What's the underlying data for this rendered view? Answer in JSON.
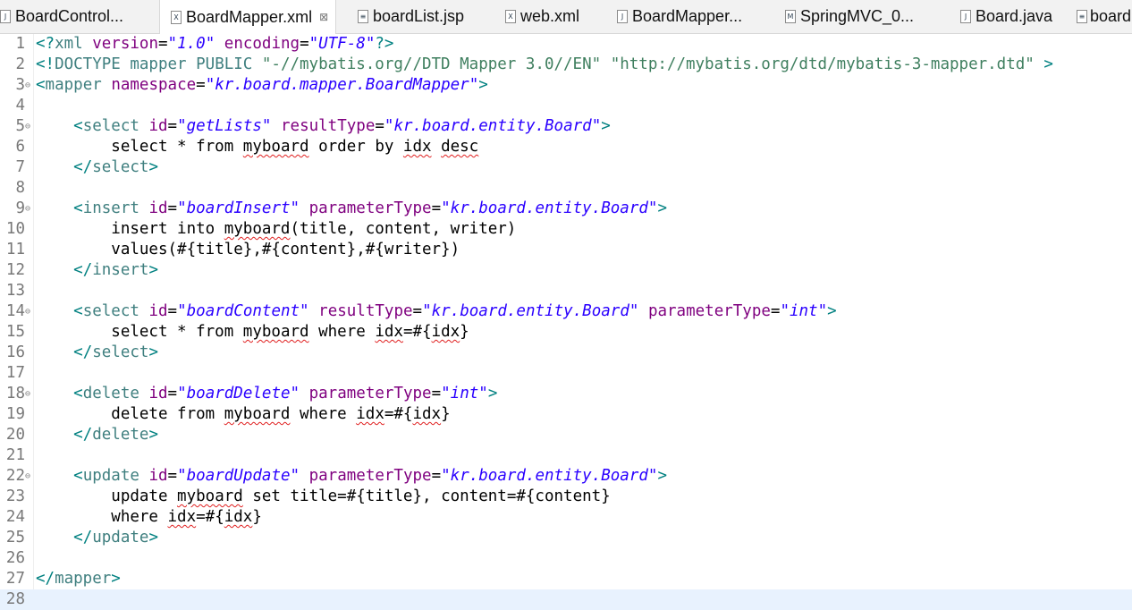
{
  "tabs": [
    {
      "label": "BoardControl...",
      "icon": "J",
      "active": false
    },
    {
      "label": "BoardMapper.xml",
      "icon": "X",
      "active": true
    },
    {
      "label": "boardList.jsp",
      "icon": "≡",
      "active": false
    },
    {
      "label": "web.xml",
      "icon": "X",
      "active": false
    },
    {
      "label": "BoardMapper...",
      "icon": "J",
      "active": false
    },
    {
      "label": "SpringMVC_0...",
      "icon": "M",
      "active": false
    },
    {
      "label": "Board.java",
      "icon": "J",
      "active": false
    },
    {
      "label": "board",
      "icon": "≡",
      "active": false
    }
  ],
  "close_glyph": "⊠",
  "fold_lines": [
    3,
    5,
    9,
    14,
    18,
    22
  ],
  "current_line": 28,
  "lines": [
    [
      [
        "br",
        "<?"
      ],
      [
        "tag",
        "xml"
      ],
      [
        "txt",
        " "
      ],
      [
        "attr",
        "version"
      ],
      [
        "txt",
        "="
      ],
      [
        "val",
        "\"1.0\""
      ],
      [
        "txt",
        " "
      ],
      [
        "attr",
        "encoding"
      ],
      [
        "txt",
        "="
      ],
      [
        "val",
        "\"UTF-8\""
      ],
      [
        "br",
        "?>"
      ]
    ],
    [
      [
        "br",
        "<!"
      ],
      [
        "dt",
        "DOCTYPE mapper PUBLIC "
      ],
      [
        "str",
        "\"-//mybatis.org//DTD Mapper 3.0//EN\" \"http://mybatis.org/dtd/mybatis-3-mapper.dtd\""
      ],
      [
        "br",
        " >"
      ]
    ],
    [
      [
        "br",
        "<"
      ],
      [
        "tag",
        "mapper"
      ],
      [
        "txt",
        " "
      ],
      [
        "attr",
        "namespace"
      ],
      [
        "txt",
        "="
      ],
      [
        "val",
        "\"kr.board.mapper.BoardMapper\""
      ],
      [
        "br",
        ">"
      ]
    ],
    [],
    [
      [
        "txt",
        "    "
      ],
      [
        "br",
        "<"
      ],
      [
        "tag",
        "select"
      ],
      [
        "txt",
        " "
      ],
      [
        "attr",
        "id"
      ],
      [
        "txt",
        "="
      ],
      [
        "val",
        "\"getLists\""
      ],
      [
        "txt",
        " "
      ],
      [
        "attr",
        "resultType"
      ],
      [
        "txt",
        "="
      ],
      [
        "val",
        "\"kr.board.entity.Board\""
      ],
      [
        "br",
        ">"
      ]
    ],
    [
      [
        "txt",
        "        select * from "
      ],
      [
        "sp",
        "myboard"
      ],
      [
        "txt",
        " order by "
      ],
      [
        "sp",
        "idx"
      ],
      [
        "txt",
        " "
      ],
      [
        "sp",
        "desc"
      ]
    ],
    [
      [
        "txt",
        "    "
      ],
      [
        "br",
        "</"
      ],
      [
        "tag",
        "select"
      ],
      [
        "br",
        ">"
      ]
    ],
    [],
    [
      [
        "txt",
        "    "
      ],
      [
        "br",
        "<"
      ],
      [
        "tag",
        "insert"
      ],
      [
        "txt",
        " "
      ],
      [
        "attr",
        "id"
      ],
      [
        "txt",
        "="
      ],
      [
        "val",
        "\"boardInsert\""
      ],
      [
        "txt",
        " "
      ],
      [
        "attr",
        "parameterType"
      ],
      [
        "txt",
        "="
      ],
      [
        "val",
        "\"kr.board.entity.Board\""
      ],
      [
        "br",
        ">"
      ]
    ],
    [
      [
        "txt",
        "        insert into "
      ],
      [
        "sp",
        "myboard"
      ],
      [
        "txt",
        "(title, content, writer)"
      ]
    ],
    [
      [
        "txt",
        "        values(#{title},#{content},#{writer})"
      ]
    ],
    [
      [
        "txt",
        "    "
      ],
      [
        "br",
        "</"
      ],
      [
        "tag",
        "insert"
      ],
      [
        "br",
        ">"
      ]
    ],
    [],
    [
      [
        "txt",
        "    "
      ],
      [
        "br",
        "<"
      ],
      [
        "tag",
        "select"
      ],
      [
        "txt",
        " "
      ],
      [
        "attr",
        "id"
      ],
      [
        "txt",
        "="
      ],
      [
        "val",
        "\"boardContent\""
      ],
      [
        "txt",
        " "
      ],
      [
        "attr",
        "resultType"
      ],
      [
        "txt",
        "="
      ],
      [
        "val",
        "\"kr.board.entity.Board\""
      ],
      [
        "txt",
        " "
      ],
      [
        "attr",
        "parameterType"
      ],
      [
        "txt",
        "="
      ],
      [
        "val",
        "\"int\""
      ],
      [
        "br",
        ">"
      ]
    ],
    [
      [
        "txt",
        "        select * from "
      ],
      [
        "sp",
        "myboard"
      ],
      [
        "txt",
        " where "
      ],
      [
        "sp",
        "idx"
      ],
      [
        "txt",
        "=#{"
      ],
      [
        "sp",
        "idx"
      ],
      [
        "txt",
        "}"
      ]
    ],
    [
      [
        "txt",
        "    "
      ],
      [
        "br",
        "</"
      ],
      [
        "tag",
        "select"
      ],
      [
        "br",
        ">"
      ]
    ],
    [],
    [
      [
        "txt",
        "    "
      ],
      [
        "br",
        "<"
      ],
      [
        "tag",
        "delete"
      ],
      [
        "txt",
        " "
      ],
      [
        "attr",
        "id"
      ],
      [
        "txt",
        "="
      ],
      [
        "val",
        "\"boardDelete\""
      ],
      [
        "txt",
        " "
      ],
      [
        "attr",
        "parameterType"
      ],
      [
        "txt",
        "="
      ],
      [
        "val",
        "\"int\""
      ],
      [
        "br",
        ">"
      ]
    ],
    [
      [
        "txt",
        "        delete from "
      ],
      [
        "sp",
        "myboard"
      ],
      [
        "txt",
        " where "
      ],
      [
        "sp",
        "idx"
      ],
      [
        "txt",
        "=#{"
      ],
      [
        "sp",
        "idx"
      ],
      [
        "txt",
        "}"
      ]
    ],
    [
      [
        "txt",
        "    "
      ],
      [
        "br",
        "</"
      ],
      [
        "tag",
        "delete"
      ],
      [
        "br",
        ">"
      ]
    ],
    [],
    [
      [
        "txt",
        "    "
      ],
      [
        "br",
        "<"
      ],
      [
        "tag",
        "update"
      ],
      [
        "txt",
        " "
      ],
      [
        "attr",
        "id"
      ],
      [
        "txt",
        "="
      ],
      [
        "val",
        "\"boardUpdate\""
      ],
      [
        "txt",
        " "
      ],
      [
        "attr",
        "parameterType"
      ],
      [
        "txt",
        "="
      ],
      [
        "val",
        "\"kr.board.entity.Board\""
      ],
      [
        "br",
        ">"
      ]
    ],
    [
      [
        "txt",
        "        update "
      ],
      [
        "sp",
        "myboard"
      ],
      [
        "txt",
        " set title=#{title}, content=#{content}"
      ]
    ],
    [
      [
        "txt",
        "        where "
      ],
      [
        "sp",
        "idx"
      ],
      [
        "txt",
        "=#{"
      ],
      [
        "sp",
        "idx"
      ],
      [
        "txt",
        "}"
      ]
    ],
    [
      [
        "txt",
        "    "
      ],
      [
        "br",
        "</"
      ],
      [
        "tag",
        "update"
      ],
      [
        "br",
        ">"
      ]
    ],
    [],
    [
      [
        "br",
        "</"
      ],
      [
        "tag",
        "mapper"
      ],
      [
        "br",
        ">"
      ]
    ],
    []
  ]
}
